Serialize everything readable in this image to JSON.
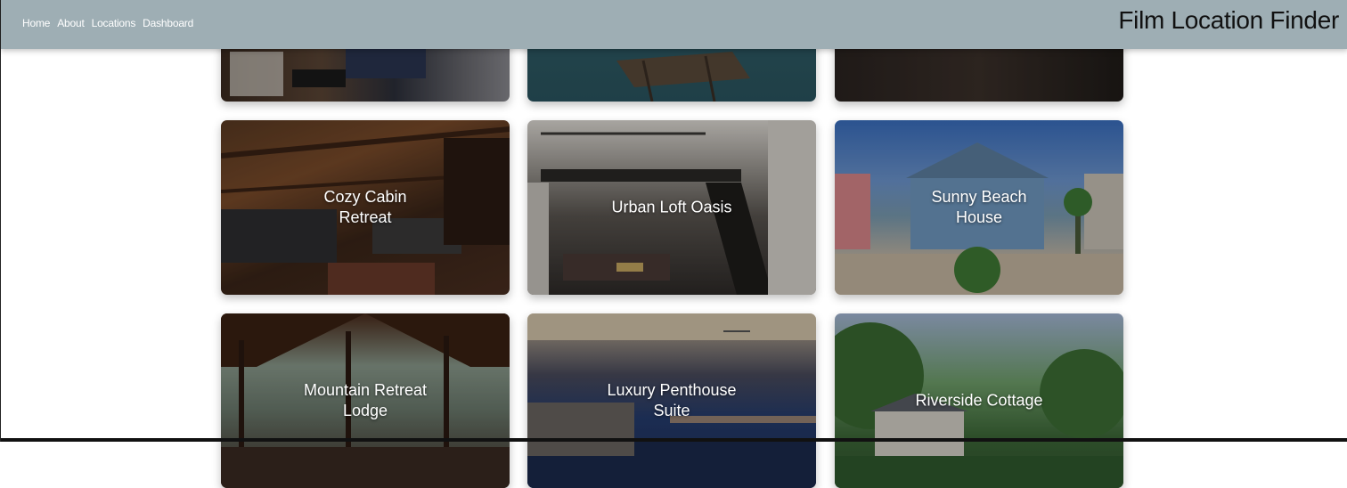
{
  "nav": {
    "links": [
      "Home",
      "About",
      "Locations",
      "Dashboard"
    ],
    "site_title": "Film Location Finder"
  },
  "cards": [
    {
      "title": ""
    },
    {
      "title": ""
    },
    {
      "title": ""
    },
    {
      "title": "Cozy Cabin Retreat"
    },
    {
      "title": "Urban Loft Oasis"
    },
    {
      "title": "Sunny Beach House"
    },
    {
      "title": "Mountain Retreat Lodge"
    },
    {
      "title": "Luxury Penthouse Suite"
    },
    {
      "title": "Riverside Cottage"
    }
  ],
  "colors": {
    "navbar_bg": "#9eaeb4",
    "title_text": "#111111"
  }
}
